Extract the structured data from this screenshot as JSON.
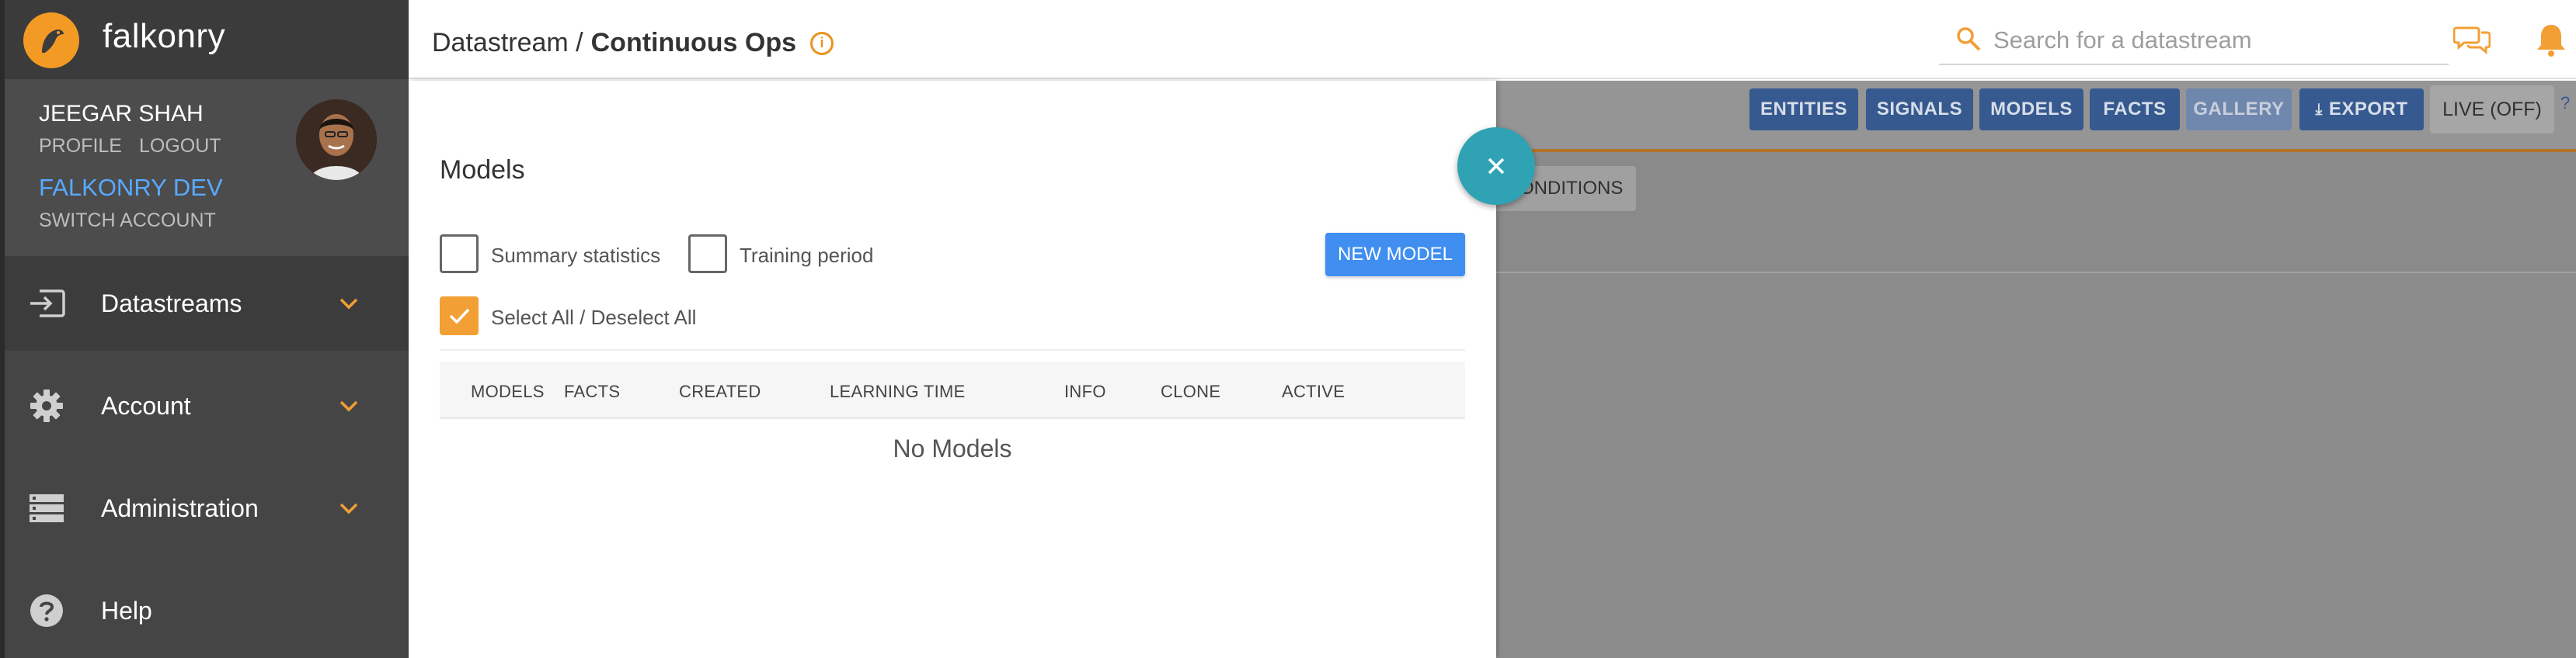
{
  "brand": {
    "name": "falkonry"
  },
  "user": {
    "name": "JEEGAR SHAH",
    "profile_label": "PROFILE",
    "logout_label": "LOGOUT",
    "org": "FALKONRY DEV",
    "switch_label": "SWITCH ACCOUNT"
  },
  "nav": [
    {
      "label": "Datastreams",
      "icon": "datastream-icon"
    },
    {
      "label": "Account",
      "icon": "gear-icon"
    },
    {
      "label": "Administration",
      "icon": "server-icon"
    },
    {
      "label": "Help",
      "icon": "help-icon"
    }
  ],
  "header": {
    "breadcrumb_prefix": "Datastream /",
    "breadcrumb_current": "Continuous Ops",
    "search_placeholder": "Search for a datastream"
  },
  "toolbar": {
    "entities": "ENTITIES",
    "signals": "SIGNALS",
    "models": "MODELS",
    "facts": "FACTS",
    "gallery": "GALLERY",
    "export": "EXPORT",
    "live": "LIVE (OFF)",
    "help": "?",
    "conditions": "CONDITIONS"
  },
  "drawer": {
    "title": "Models",
    "summary_stats_label": "Summary statistics",
    "training_period_label": "Training period",
    "select_all_label": "Select All / Deselect All",
    "new_model_label": "NEW MODEL",
    "columns": [
      "MODELS",
      "FACTS",
      "CREATED",
      "LEARNING TIME",
      "INFO",
      "CLONE",
      "ACTIVE"
    ],
    "empty_text": "No Models"
  },
  "colors": {
    "accent_orange": "#f29f35",
    "primary_blue": "#3f8ef0",
    "fab_teal": "#2fa3b3",
    "sidebar_bg": "#454545"
  }
}
